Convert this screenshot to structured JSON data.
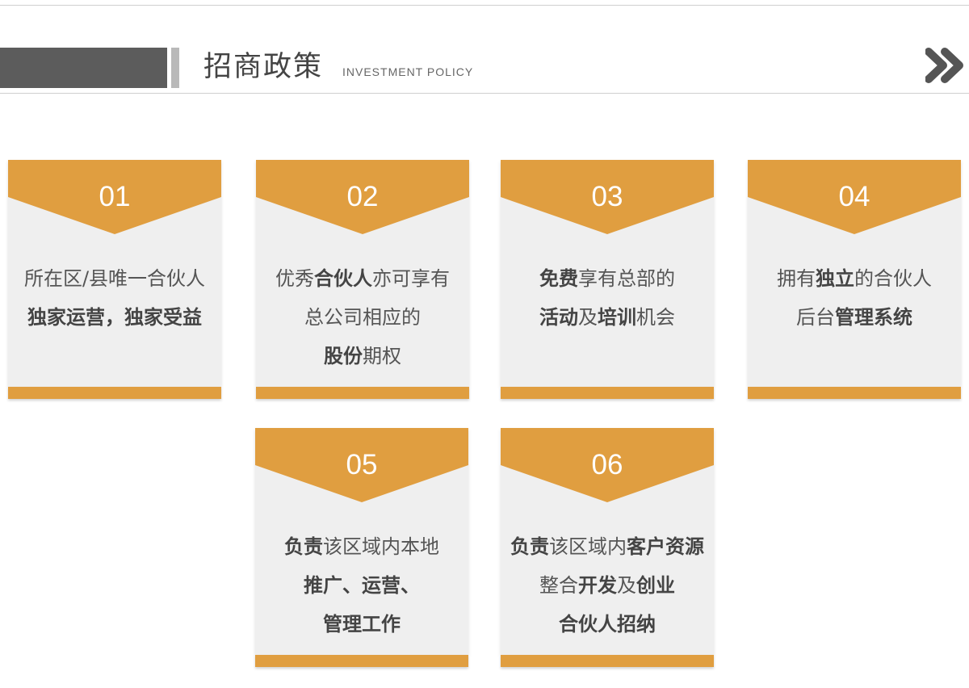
{
  "header": {
    "title": "招商政策",
    "subtitle": "INVESTMENT POLICY"
  },
  "colors": {
    "accent": "#e09e40",
    "dark_block": "#5c5c5c",
    "card_bg": "#efefef"
  },
  "cards": [
    {
      "number": "01",
      "lines": [
        [
          {
            "t": "所在区/县唯一合伙人",
            "b": false
          }
        ],
        [
          {
            "t": "独家运营，独家受益",
            "b": true
          }
        ]
      ]
    },
    {
      "number": "02",
      "lines": [
        [
          {
            "t": "优秀",
            "b": false
          },
          {
            "t": "合伙人",
            "b": true
          },
          {
            "t": "亦可享有",
            "b": false
          }
        ],
        [
          {
            "t": "总公司相应的",
            "b": false
          }
        ],
        [
          {
            "t": "股份",
            "b": true
          },
          {
            "t": "期权",
            "b": false
          }
        ]
      ]
    },
    {
      "number": "03",
      "lines": [
        [
          {
            "t": "免费",
            "b": true
          },
          {
            "t": "享有总部的",
            "b": false
          }
        ],
        [
          {
            "t": "活动",
            "b": true
          },
          {
            "t": "及",
            "b": false
          },
          {
            "t": "培训",
            "b": true
          },
          {
            "t": "机会",
            "b": false
          }
        ]
      ]
    },
    {
      "number": "04",
      "lines": [
        [
          {
            "t": "拥有",
            "b": false
          },
          {
            "t": "独立",
            "b": true
          },
          {
            "t": "的合伙人",
            "b": false
          }
        ],
        [
          {
            "t": "后台",
            "b": false
          },
          {
            "t": "管理系统",
            "b": true
          }
        ]
      ]
    },
    {
      "number": "05",
      "lines": [
        [
          {
            "t": "负责",
            "b": true
          },
          {
            "t": "该区域内本地",
            "b": false
          }
        ],
        [
          {
            "t": "推广、运营、",
            "b": true
          }
        ],
        [
          {
            "t": "管理工作",
            "b": true
          }
        ]
      ]
    },
    {
      "number": "06",
      "lines": [
        [
          {
            "t": "负责",
            "b": true
          },
          {
            "t": "该区域内",
            "b": false
          },
          {
            "t": "客户资源",
            "b": true
          }
        ],
        [
          {
            "t": "整合",
            "b": false
          },
          {
            "t": "开发",
            "b": true
          },
          {
            "t": "及",
            "b": false
          },
          {
            "t": "创业",
            "b": true
          }
        ],
        [
          {
            "t": "合伙人招纳",
            "b": true
          }
        ]
      ]
    }
  ]
}
